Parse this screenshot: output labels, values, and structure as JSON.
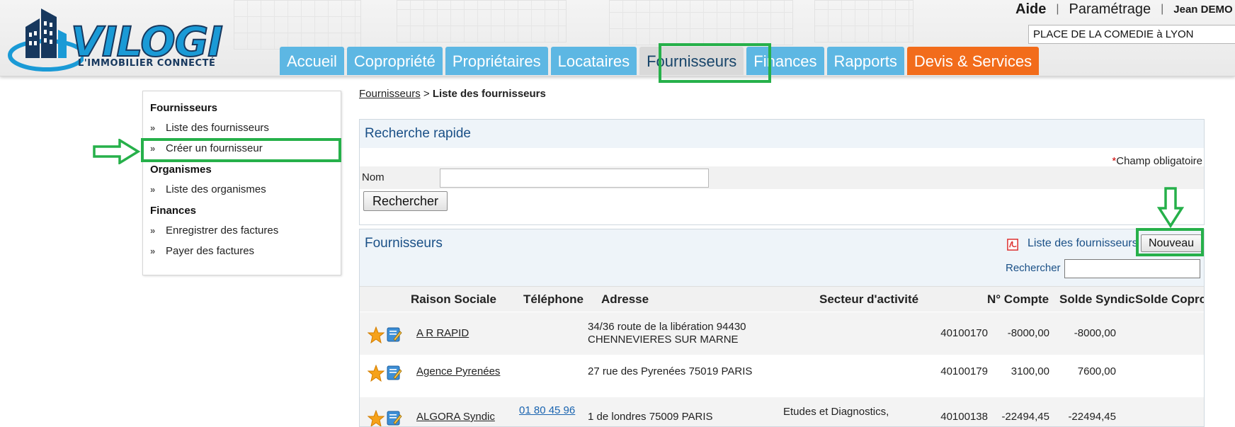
{
  "brand": {
    "name": "VILOGI",
    "tagline": "L'IMMOBILIER CONNECTÉ",
    "color_primary": "#1a9ad6",
    "color_dark": "#17385e"
  },
  "top_links": {
    "help": "Aide",
    "settings": "Paramétrage",
    "user": "Jean DEMO"
  },
  "copro_selector": {
    "value": "PLACE DE LA COMEDIE à LYON"
  },
  "nav": {
    "tabs": [
      {
        "label": "Accueil"
      },
      {
        "label": "Copropriété"
      },
      {
        "label": "Propriétaires"
      },
      {
        "label": "Locataires"
      },
      {
        "label": "Fournisseurs",
        "active": true
      },
      {
        "label": "Finances"
      },
      {
        "label": "Rapports"
      },
      {
        "label": "Devis & Services",
        "accent": "#f26c1b"
      }
    ]
  },
  "sidebar": {
    "sections": [
      {
        "title": "Fournisseurs",
        "items": [
          "Liste des fournisseurs",
          "Créer un fournisseur"
        ]
      },
      {
        "title": "Organismes",
        "items": [
          "Liste des organismes"
        ]
      },
      {
        "title": "Finances",
        "items": [
          "Enregistrer des factures",
          "Payer des factures"
        ]
      }
    ]
  },
  "breadcrumb": {
    "parent": "Fournisseurs",
    "separator": ">",
    "current": "Liste des fournisseurs"
  },
  "quick_search": {
    "title": "Recherche rapide",
    "required_star": "*",
    "required_note": "Champ obligatoire",
    "name_label": "Nom",
    "name_value": "",
    "search_button": "Rechercher"
  },
  "supplier_list": {
    "title": "Fournisseurs",
    "pdf_link": "Liste des fournisseurs",
    "new_button": "Nouveau",
    "filter_label": "Rechercher",
    "filter_value": "",
    "columns": [
      "Raison Sociale",
      "Téléphone",
      "Adresse",
      "Secteur d'activité",
      "N° Compte",
      "Solde Syndic",
      "Solde Copro"
    ],
    "rows": [
      {
        "name": "A R RAPID",
        "phone": "",
        "address_line1": "34/36 route de la libération 94430",
        "address_line2": "CHENNEVIERES SUR MARNE",
        "sector": "",
        "account": "40100170",
        "solde_syndic": "-8000,00",
        "solde_copro": "-8000,00"
      },
      {
        "name": "Agence Pyrenées",
        "phone": "",
        "address_line1": "27 rue des Pyrenées 75019 PARIS",
        "address_line2": "",
        "sector": "",
        "account": "40100179",
        "solde_syndic": "3100,00",
        "solde_copro": "7600,00"
      },
      {
        "name": "ALGORA Syndic",
        "phone": "01 80 45 96",
        "address_line1": "1 de londres 75009 PARIS",
        "address_line2": "",
        "sector": "Etudes et Diagnostics,",
        "account": "40100138",
        "solde_syndic": "-22494,45",
        "solde_copro": "-22494,45"
      }
    ]
  },
  "annotations": {
    "highlight_color": "#26b04a"
  }
}
